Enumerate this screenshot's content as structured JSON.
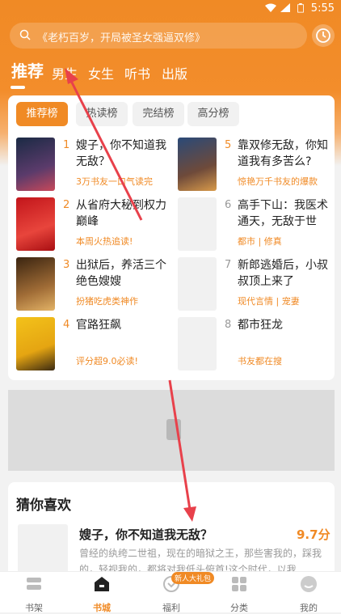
{
  "status": {
    "time": "5:55"
  },
  "search": {
    "placeholder": "《老朽百岁，开局被圣女强逼双修》"
  },
  "tabs": [
    "推荐",
    "男生",
    "女生",
    "听书",
    "出版"
  ],
  "rank_tabs": [
    "推荐榜",
    "热读榜",
    "完结榜",
    "高分榜"
  ],
  "books": [
    {
      "rank": "1",
      "title": "嫂子，你不知道我无敌？",
      "sub": "3万书友一口气读完"
    },
    {
      "rank": "2",
      "title": "从省府大秘到权力巅峰",
      "sub": "本周火热追读!"
    },
    {
      "rank": "3",
      "title": "出狱后，养活三个绝色嫂嫂",
      "sub": "扮猪吃虎类神作"
    },
    {
      "rank": "4",
      "title": "官路狂飙",
      "sub": "评分超9.0必读!"
    },
    {
      "rank": "5",
      "title": "靠双修无敌，你知道我有多苦么?",
      "sub": "惊艳万千书友的爆款"
    },
    {
      "rank": "6",
      "title": "高手下山：我医术通天，无敌于世",
      "sub": "都市 | 修真"
    },
    {
      "rank": "7",
      "title": "新郎逃婚后，小叔叔顶上来了",
      "sub": "现代言情 | 宠妻"
    },
    {
      "rank": "8",
      "title": "都市狂龙",
      "sub": "书友都在搜"
    }
  ],
  "guess": {
    "heading": "猜你喜欢",
    "title": "嫂子，你不知道我无敌？",
    "score": "9.7分",
    "desc": "曾经的纨绔二世祖，现在的暗狱之王，那些害我的，踩我的，轻视我的，都将对我低头俯首!这个时代，以我..."
  },
  "nav": [
    {
      "label": "书架",
      "icon": "shelf-icon"
    },
    {
      "label": "书城",
      "icon": "home-icon",
      "active": true
    },
    {
      "label": "福利",
      "icon": "gift-icon",
      "badge": "新人大礼包"
    },
    {
      "label": "分类",
      "icon": "grid-icon"
    },
    {
      "label": "我的",
      "icon": "user-icon"
    }
  ],
  "colors": {
    "accent": "#f08a25",
    "arrow": "#e8414b"
  }
}
